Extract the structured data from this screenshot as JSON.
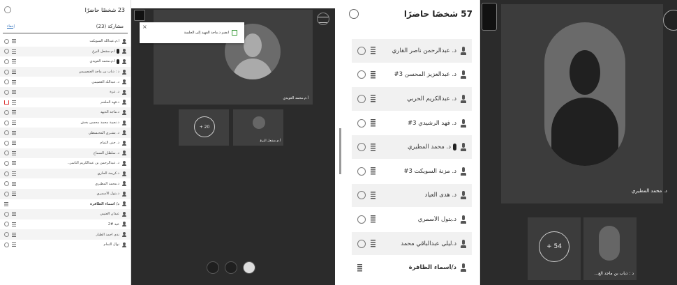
{
  "left": {
    "panel": {
      "title": "23 شخصًا حاضرًا",
      "section_label": "مشاركة (23)",
      "section_link": "إخفاء",
      "participants": [
        "أ.م.عبدالله السويكت",
        "أ.م.مشعل البرغ",
        "أ.م.محمد العويدي",
        "د : ذياب بن ماجد العنصبيمي",
        "د. عبدالله العصيمي",
        "د. عزة",
        "د.فهد الملحم",
        "د.ماجد الدبهد",
        "د.نجيبة محمد محسن بخش",
        "د. بشـري المحـسطي",
        "د. جنى التمام",
        "د. سلطان السماح",
        "د. عبدالرحمن بن عبدالكريم التاسر..",
        "د.كريمة الحازي",
        "د.محمد المطيري",
        "د.بتول الأسمري",
        "د/ أسماء الظافرة",
        "عبدان العتيبي",
        "عيد #2",
        "ندى أحمد الطيار",
        "نوال التمام"
      ]
    },
    "stage": {
      "notice": "انضم د.ماجد الفهيد إلى الجلسة",
      "main_label": "أ.م.محمد العويدي",
      "tile_count": "+ 20",
      "tile_label": "أ.م.مشعل البرغ"
    }
  },
  "right": {
    "panel": {
      "title": "57 شخصًا حاضرًا",
      "participants": [
        "د. عبدالرحمن ناصر القاري",
        "د. عبدالعزيز المحسن 3#",
        "د. عبدالكريم الحربي",
        "د. فهد الرشيدي 3#",
        "د. محمد المطيري",
        "د. مزنة السويكت 3#",
        "د. هدى العياد",
        "د.بتول الأسمري",
        "د.ليلى عبدالباقي محمد",
        "د/أسماء الظافرة"
      ]
    },
    "stage": {
      "main_label": "د. محمد المطيري",
      "tile_count": "+ 54",
      "tile_label": "د : ذياب بن ماجد الع..."
    }
  }
}
